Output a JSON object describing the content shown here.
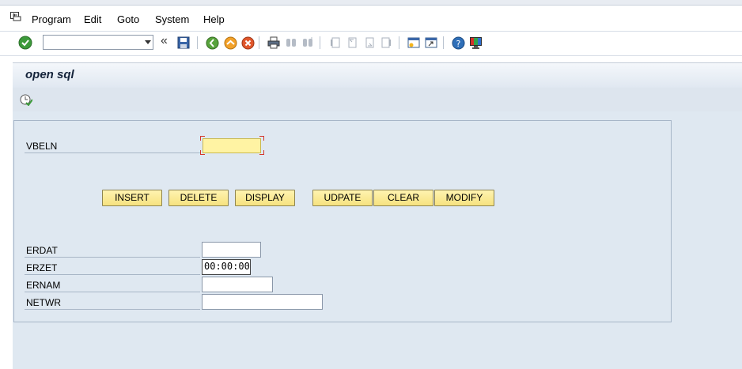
{
  "menu": {
    "items": [
      "Program",
      "Edit",
      "Goto",
      "System",
      "Help"
    ]
  },
  "toolbar": {
    "command_value": "",
    "icons": [
      "enter-icon",
      "save-icon",
      "back-icon",
      "exit-icon",
      "cancel-icon",
      "print-icon",
      "find-icon",
      "find-next-icon",
      "first-page-icon",
      "previous-page-icon",
      "next-page-icon",
      "last-page-icon",
      "create-session-icon",
      "shortcut-icon",
      "help-icon",
      "customize-layout-icon"
    ]
  },
  "screen": {
    "title": "open sql"
  },
  "form": {
    "vbeln_label": "VBELN",
    "vbeln_value": "",
    "buttons": {
      "insert": "INSERT",
      "delete": "DELETE",
      "display": "DISPLAY",
      "udpate": "UDPATE",
      "clear": "CLEAR",
      "modify": "MODIFY"
    },
    "erdat_label": "ERDAT",
    "erdat_value": "",
    "erzet_label": "ERZET",
    "erzet_value": "00:00:00",
    "ernam_label": "ERNAM",
    "ernam_value": "",
    "netwr_label": "NETWR",
    "netwr_value": ""
  },
  "colors": {
    "button_bg": "#f6e27f",
    "required_field_bg": "#fff3a3",
    "area_bg": "#dfe8f1"
  }
}
